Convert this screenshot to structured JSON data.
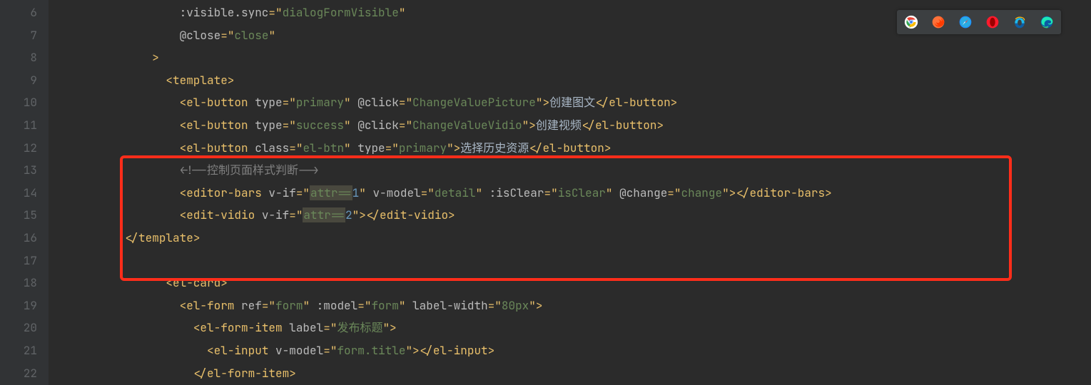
{
  "line_numbers": [
    "6",
    "7",
    "8",
    "9",
    "10",
    "11",
    "12",
    "13",
    "14",
    "15",
    "16",
    "17",
    "18",
    "19",
    "20",
    "21",
    "22"
  ],
  "code": {
    "l6": {
      "indent": 8,
      "tokens": [
        {
          "t": ":visible.sync",
          "c": "attr"
        },
        {
          "t": "=\"",
          "c": "punct"
        },
        {
          "t": "dialogFormVisible",
          "c": "str"
        },
        {
          "t": "\"",
          "c": "punct"
        }
      ]
    },
    "l7": {
      "indent": 8,
      "tokens": [
        {
          "t": "@close",
          "c": "attr"
        },
        {
          "t": "=\"",
          "c": "punct"
        },
        {
          "t": "close",
          "c": "str"
        },
        {
          "t": "\"",
          "c": "punct"
        }
      ]
    },
    "l8": {
      "indent": 6,
      "tokens": [
        {
          "t": ">",
          "c": "punct"
        }
      ]
    },
    "l9": {
      "indent": 7,
      "tokens": [
        {
          "t": "<template>",
          "c": "tag"
        }
      ]
    },
    "l10": {
      "indent": 8,
      "tokens": [
        {
          "t": "<el-button ",
          "c": "tag"
        },
        {
          "t": "type",
          "c": "attr"
        },
        {
          "t": "=\"",
          "c": "punct"
        },
        {
          "t": "primary",
          "c": "str"
        },
        {
          "t": "\" ",
          "c": "punct"
        },
        {
          "t": "@click",
          "c": "attr"
        },
        {
          "t": "=\"",
          "c": "punct"
        },
        {
          "t": "ChangeValuePicture",
          "c": "str"
        },
        {
          "t": "\">",
          "c": "punct"
        },
        {
          "t": "创建图文",
          "c": "txt"
        },
        {
          "t": "</el-button>",
          "c": "tag"
        }
      ]
    },
    "l11": {
      "indent": 8,
      "tokens": [
        {
          "t": "<el-button ",
          "c": "tag"
        },
        {
          "t": "type",
          "c": "attr"
        },
        {
          "t": "=\"",
          "c": "punct"
        },
        {
          "t": "success",
          "c": "str"
        },
        {
          "t": "\" ",
          "c": "punct"
        },
        {
          "t": "@click",
          "c": "attr"
        },
        {
          "t": "=\"",
          "c": "punct"
        },
        {
          "t": "ChangeValueVidio",
          "c": "str"
        },
        {
          "t": "\">",
          "c": "punct"
        },
        {
          "t": "创建视频",
          "c": "txt"
        },
        {
          "t": "</el-button>",
          "c": "tag"
        }
      ]
    },
    "l12": {
      "indent": 8,
      "tokens": [
        {
          "t": "<el-button ",
          "c": "tag"
        },
        {
          "t": "class",
          "c": "attr"
        },
        {
          "t": "=\"",
          "c": "punct"
        },
        {
          "t": "el-btn",
          "c": "str"
        },
        {
          "t": "\" ",
          "c": "punct"
        },
        {
          "t": "type",
          "c": "attr"
        },
        {
          "t": "=\"",
          "c": "punct"
        },
        {
          "t": "primary",
          "c": "str"
        },
        {
          "t": "\">",
          "c": "punct"
        },
        {
          "t": "选择历史资源",
          "c": "txt"
        },
        {
          "t": "</el-button>",
          "c": "tag"
        }
      ]
    },
    "l13": {
      "indent": 8,
      "tokens": [
        {
          "t": "<!--控制页面样式判断-->",
          "c": "comment"
        }
      ]
    },
    "l14": {
      "indent": 8,
      "tokens": [
        {
          "t": "<editor-bars ",
          "c": "tag"
        },
        {
          "t": "v-if",
          "c": "attr"
        },
        {
          "t": "=\"",
          "c": "punct"
        },
        {
          "t": "attr==",
          "c": "str hilite"
        },
        {
          "t": "1",
          "c": "num"
        },
        {
          "t": "\" ",
          "c": "punct"
        },
        {
          "t": "v-model",
          "c": "attr"
        },
        {
          "t": "=\"",
          "c": "punct"
        },
        {
          "t": "detail",
          "c": "str"
        },
        {
          "t": "\" ",
          "c": "punct"
        },
        {
          "t": ":isClear",
          "c": "attr"
        },
        {
          "t": "=\"",
          "c": "punct"
        },
        {
          "t": "isClear",
          "c": "str"
        },
        {
          "t": "\" ",
          "c": "punct"
        },
        {
          "t": "@change",
          "c": "attr"
        },
        {
          "t": "=\"",
          "c": "punct"
        },
        {
          "t": "change",
          "c": "str"
        },
        {
          "t": "\">",
          "c": "punct"
        },
        {
          "t": "</editor-bars>",
          "c": "tag"
        }
      ]
    },
    "l15": {
      "indent": 8,
      "tokens": [
        {
          "t": "<edit-vidio ",
          "c": "tag"
        },
        {
          "t": "v-if",
          "c": "attr"
        },
        {
          "t": "=\"",
          "c": "punct"
        },
        {
          "t": "attr==",
          "c": "str hilite"
        },
        {
          "t": "2",
          "c": "num"
        },
        {
          "t": "\">",
          "c": "punct"
        },
        {
          "t": "</edit-vidio>",
          "c": "tag"
        }
      ]
    },
    "l16": {
      "indent": 4,
      "tokens": [
        {
          "t": "</template>",
          "c": "tag"
        }
      ]
    },
    "l17": {
      "indent": 0,
      "tokens": [
        {
          "t": "",
          "c": "txt"
        }
      ]
    },
    "l18": {
      "indent": 7,
      "tokens": [
        {
          "t": "<el-card>",
          "c": "tag"
        }
      ]
    },
    "l19": {
      "indent": 8,
      "tokens": [
        {
          "t": "<el-form ",
          "c": "tag"
        },
        {
          "t": "ref",
          "c": "attr"
        },
        {
          "t": "=\"",
          "c": "punct"
        },
        {
          "t": "form",
          "c": "str"
        },
        {
          "t": "\" ",
          "c": "punct"
        },
        {
          "t": ":model",
          "c": "attr"
        },
        {
          "t": "=\"",
          "c": "punct"
        },
        {
          "t": "form",
          "c": "str"
        },
        {
          "t": "\" ",
          "c": "punct"
        },
        {
          "t": "label-width",
          "c": "attr"
        },
        {
          "t": "=\"",
          "c": "punct"
        },
        {
          "t": "80px",
          "c": "str"
        },
        {
          "t": "\">",
          "c": "punct"
        }
      ]
    },
    "l20": {
      "indent": 9,
      "tokens": [
        {
          "t": "<el-form-item ",
          "c": "tag"
        },
        {
          "t": "label",
          "c": "attr"
        },
        {
          "t": "=\"",
          "c": "punct"
        },
        {
          "t": "发布标题",
          "c": "str"
        },
        {
          "t": "\">",
          "c": "punct"
        }
      ]
    },
    "l21": {
      "indent": 10,
      "tokens": [
        {
          "t": "<el-input ",
          "c": "tag"
        },
        {
          "t": "v-model",
          "c": "attr"
        },
        {
          "t": "=\"",
          "c": "punct"
        },
        {
          "t": "form.title",
          "c": "str"
        },
        {
          "t": "\">",
          "c": "punct"
        },
        {
          "t": "</el-input>",
          "c": "tag"
        }
      ]
    },
    "l22": {
      "indent": 9,
      "tokens": [
        {
          "t": "</el-form-item>",
          "c": "tag"
        }
      ]
    }
  },
  "fold_markers": [
    {
      "line_index": 3,
      "type": "open"
    },
    {
      "line_index": 10,
      "type": "close"
    },
    {
      "line_index": 12,
      "type": "open"
    },
    {
      "line_index": 13,
      "type": "open"
    },
    {
      "line_index": 14,
      "type": "open"
    }
  ],
  "browsers": [
    {
      "name": "chrome-icon"
    },
    {
      "name": "firefox-icon"
    },
    {
      "name": "safari-icon"
    },
    {
      "name": "opera-icon"
    },
    {
      "name": "ie-icon"
    },
    {
      "name": "edge-icon"
    }
  ]
}
